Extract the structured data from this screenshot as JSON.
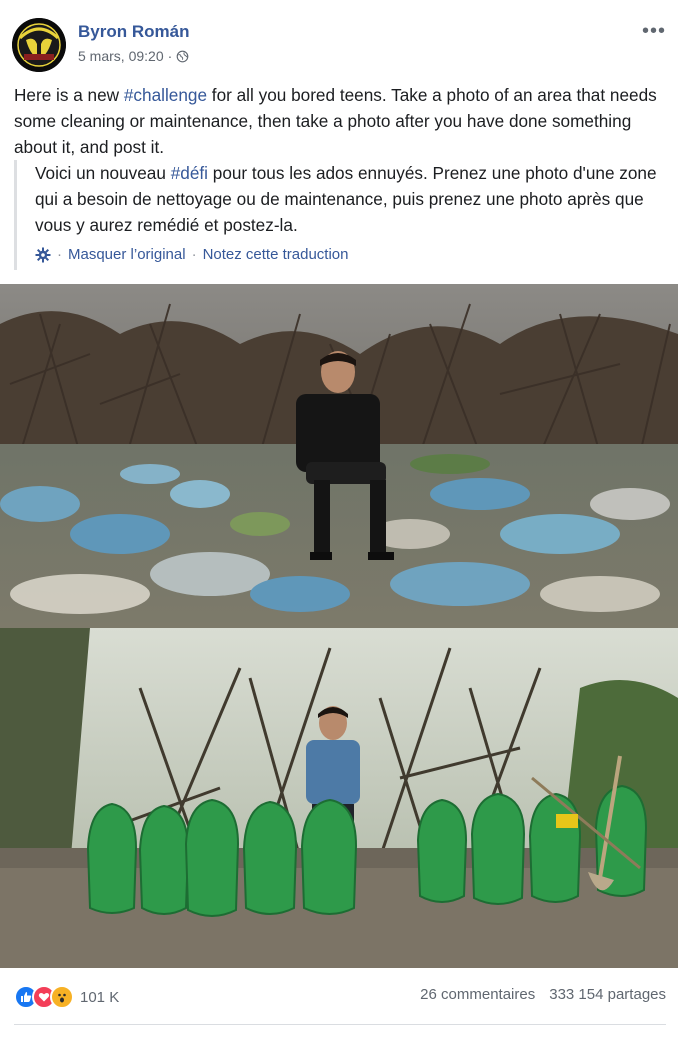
{
  "post": {
    "author": "Byron Román",
    "date": "5 mars, 09:20",
    "date_separator": "·",
    "more_label": "•••",
    "avatar_text": "PARRIS ISLAND",
    "text_parts": {
      "before": "Here is a new ",
      "hashtag": "#challenge",
      "after": " for all you bored teens. Take a photo of an area that needs some cleaning or maintenance, then take a photo after you have done something about it, and post it."
    },
    "translation": {
      "before": "Voici un nouveau ",
      "hashtag": "#défi",
      "after": " pour tous les ados ennuyés. Prenez une photo d'une zone qui a besoin de nettoyage ou de maintenance, puis prenez une photo après que vous y aurez remédié et postez-la.",
      "sep": "·",
      "hide_original": "Masquer l’original",
      "rate": "Notez cette traduction"
    },
    "photos": [
      "before-cleanup-photo",
      "after-cleanup-photo"
    ]
  },
  "footer": {
    "reaction_icons": [
      "like-icon",
      "love-icon",
      "wow-icon"
    ],
    "reaction_count": "101 K",
    "comments": "26 commentaires",
    "shares": "333 154 partages"
  },
  "colors": {
    "link": "#365899",
    "text": "#1c1e21",
    "muted": "#606770",
    "like": "#1877f2",
    "love": "#f33e58",
    "wow": "#f7b125"
  }
}
